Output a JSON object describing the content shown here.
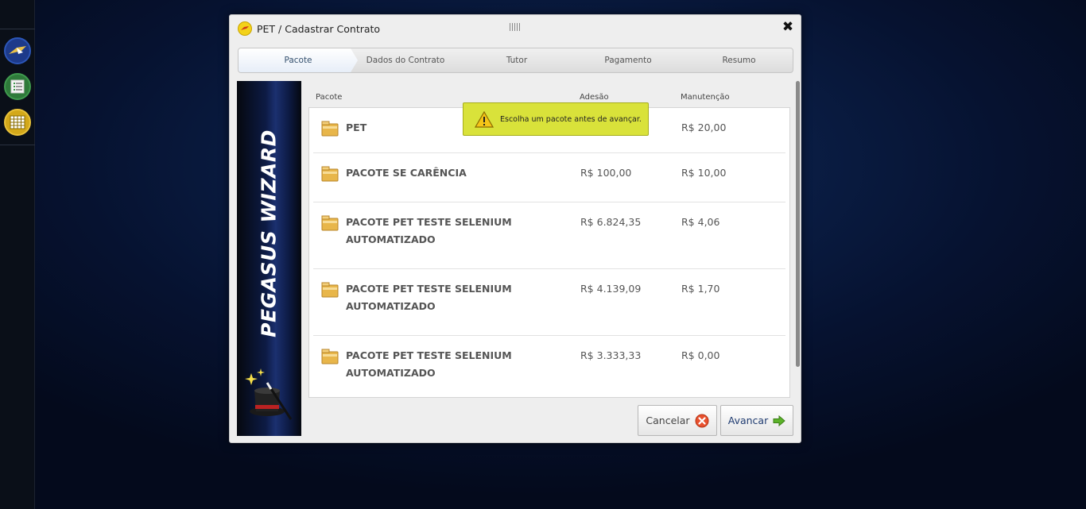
{
  "rail": {
    "buttons": [
      {
        "name": "app-logo",
        "icon": "pegasus-icon"
      },
      {
        "name": "list",
        "icon": "list-icon"
      },
      {
        "name": "grid",
        "icon": "grid-icon"
      }
    ]
  },
  "dialog": {
    "title": "PET / Cadastrar Contrato",
    "close_label": "✖"
  },
  "steps": [
    {
      "label": "Pacote",
      "active": true
    },
    {
      "label": "Dados do Contrato",
      "active": false
    },
    {
      "label": "Tutor",
      "active": false
    },
    {
      "label": "Pagamento",
      "active": false
    },
    {
      "label": "Resumo",
      "active": false
    }
  ],
  "banner": {
    "text": "PEGASUS WIZARD"
  },
  "table": {
    "headers": {
      "pacote": "Pacote",
      "adesao": "Adesão",
      "manutencao": "Manutenção"
    },
    "rows": [
      {
        "name": "PET",
        "adesao": "",
        "manutencao": "R$ 20,00"
      },
      {
        "name": "PACOTE SE CARÊNCIA",
        "adesao": "R$ 100,00",
        "manutencao": "R$ 10,00"
      },
      {
        "name": "PACOTE PET TESTE SELENIUM AUTOMATIZADO",
        "adesao": "R$ 6.824,35",
        "manutencao": "R$ 4,06"
      },
      {
        "name": "PACOTE PET TESTE SELENIUM AUTOMATIZADO",
        "adesao": "R$ 4.139,09",
        "manutencao": "R$ 1,70"
      },
      {
        "name": "PACOTE PET TESTE SELENIUM AUTOMATIZADO",
        "adesao": "R$ 3.333,33",
        "manutencao": "R$ 0,00"
      }
    ]
  },
  "warning": {
    "text": "Escolha um pacote antes de avançar.",
    "icon": "warning-icon"
  },
  "buttons": {
    "cancel": "Cancelar",
    "next": "Avancar"
  },
  "colors": {
    "warning_bg": "#d9e23a",
    "cancel_icon": "#e8502e",
    "next_icon": "#5cb32a"
  }
}
